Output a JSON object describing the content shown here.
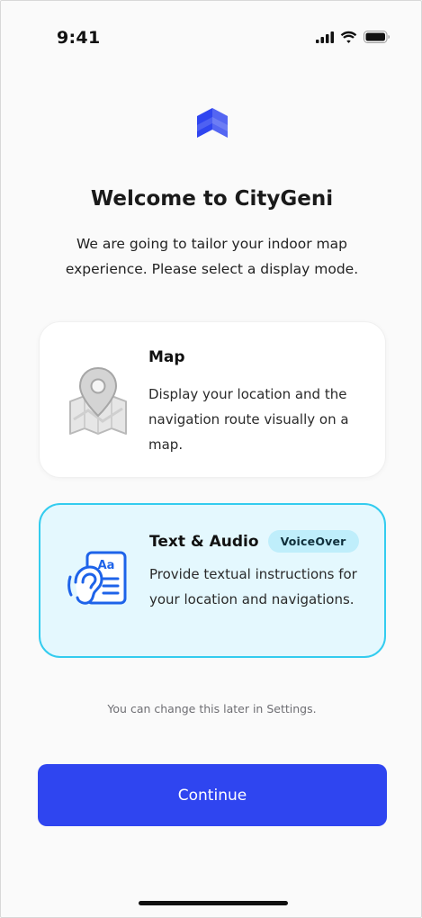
{
  "status_bar": {
    "time": "9:41",
    "icons": [
      "signal-icon",
      "wifi-icon",
      "battery-icon"
    ]
  },
  "logo_icon": "layers-logo-icon",
  "welcome": {
    "title": "Welcome to CityGeni",
    "subtitle": "We are going to tailor your indoor map experience. Please select a display mode."
  },
  "options": [
    {
      "icon": "map-pin-icon",
      "title": "Map",
      "description": "Display your location and the navigation route visually on a map.",
      "selected": false
    },
    {
      "icon": "ear-text-icon",
      "title": "Text & Audio",
      "badge": "VoiceOver",
      "description": "Provide textual instructions for your location and navigations.",
      "selected": true
    }
  ],
  "hint": "You can change this later in Settings.",
  "continue_label": "Continue",
  "colors": {
    "primary": "#2f45f0",
    "selected_bg": "#e4f8fe",
    "selected_border": "#33ccef",
    "badge_bg": "#bfeefb",
    "icon_blue": "#1e63e9"
  }
}
